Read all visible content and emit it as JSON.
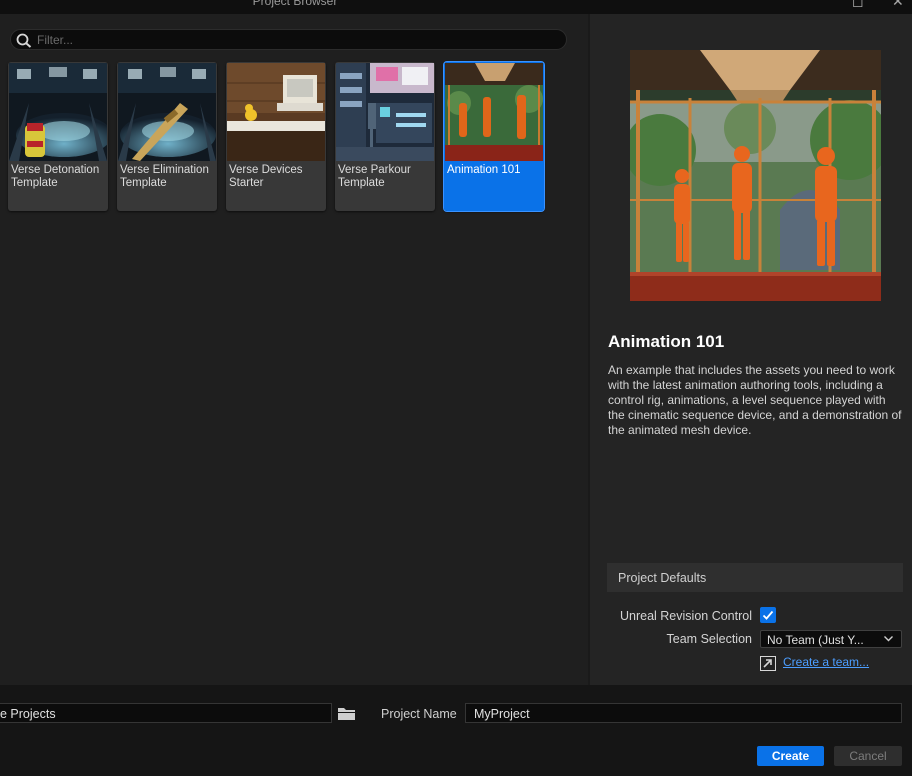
{
  "window": {
    "title": "Project Browser",
    "maximize_icon": "maximize-icon",
    "close_icon": "close-icon"
  },
  "filter": {
    "placeholder": "Filter...",
    "icon": "search-icon"
  },
  "templates": [
    {
      "label": "Verse Detonation Template",
      "selected": false
    },
    {
      "label": "Verse Elimination Template",
      "selected": false
    },
    {
      "label": "Verse Devices Starter",
      "selected": false
    },
    {
      "label": "Verse Parkour Template",
      "selected": false
    },
    {
      "label": "Animation 101",
      "selected": true
    }
  ],
  "details": {
    "title": "Animation 101",
    "description": "An example that includes the assets you need to work with the latest animation authoring tools, including a control rig, animations, a level sequence played with the cinematic sequence device, and a demonstration of the animated mesh device."
  },
  "project_defaults": {
    "header": "Project Defaults",
    "revision_control_label": "Unreal Revision Control",
    "revision_control_checked": true,
    "team_selection_label": "Team Selection",
    "team_selection_value": "No Team (Just Y...",
    "create_team_link": "Create a team..."
  },
  "bottom": {
    "location_value": "e Projects",
    "project_name_label": "Project Name",
    "project_name_value": "MyProject",
    "create_label": "Create",
    "cancel_label": "Cancel"
  },
  "colors": {
    "accent": "#0a72e8",
    "link": "#4c9eff"
  }
}
